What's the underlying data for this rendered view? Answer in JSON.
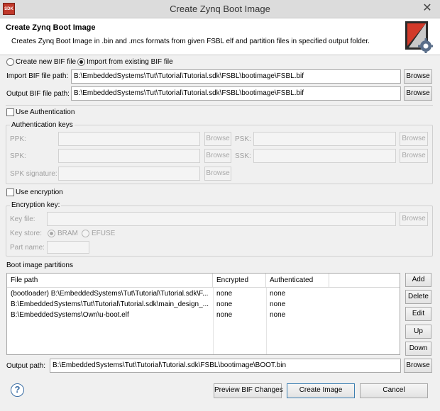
{
  "window": {
    "title": "Create Zynq Boot Image",
    "app_icon_text": "SDK",
    "close_glyph": "✕"
  },
  "header": {
    "title": "Create Zynq Boot Image",
    "description": "Creates Zynq Boot Image in .bin and .mcs formats from given FSBL elf and partition files in specified output folder."
  },
  "mode": {
    "create_new_label": "Create new BIF file",
    "import_label": "Import from existing BIF file",
    "selected": "import"
  },
  "import_bif": {
    "label": "Import BIF file path:",
    "value": "B:\\EmbeddedSystems\\Tut\\Tutorial\\Tutorial.sdk\\FSBL\\bootimage\\FSBL.bif",
    "browse_label": "Browse"
  },
  "output_bif": {
    "label": "Output BIF file path:",
    "value": "B:\\EmbeddedSystems\\Tut\\Tutorial\\Tutorial.sdk\\FSBL\\bootimage\\FSBL.bif",
    "browse_label": "Browse"
  },
  "authentication": {
    "checkbox_label": "Use Authentication",
    "checked": false,
    "group_label": "Authentication keys",
    "ppk_label": "PPK:",
    "psk_label": "PSK:",
    "spk_label": "SPK:",
    "ssk_label": "SSK:",
    "spk_signature_label": "SPK signature:",
    "browse_label": "Browse"
  },
  "encryption": {
    "checkbox_label": "Use encryption",
    "checked": false,
    "group_label": "Encryption key:",
    "key_file_label": "Key file:",
    "key_store_label": "Key store:",
    "bram_label": "BRAM",
    "efuse_label": "EFUSE",
    "key_store_selected": "BRAM",
    "part_name_label": "Part name:",
    "browse_label": "Browse"
  },
  "partitions": {
    "section_label": "Boot image partitions",
    "columns": [
      "File path",
      "Encrypted",
      "Authenticated"
    ],
    "rows": [
      {
        "path": "(bootloader) B:\\EmbeddedSystems\\Tut\\Tutorial\\Tutorial.sdk\\F...",
        "encrypted": "none",
        "authenticated": "none"
      },
      {
        "path": "B:\\EmbeddedSystems\\Tut\\Tutorial\\Tutorial.sdk\\main_design_...",
        "encrypted": "none",
        "authenticated": "none"
      },
      {
        "path": "B:\\EmbeddedSystems\\Own\\u-boot.elf",
        "encrypted": "none",
        "authenticated": "none"
      }
    ],
    "buttons": {
      "add": "Add",
      "delete": "Delete",
      "edit": "Edit",
      "up": "Up",
      "down": "Down"
    }
  },
  "output_path": {
    "label": "Output path:",
    "value": "B:\\EmbeddedSystems\\Tut\\Tutorial\\Tutorial.sdk\\FSBL\\bootimage\\BOOT.bin",
    "browse_label": "Browse"
  },
  "footer": {
    "help_glyph": "?",
    "preview_label": "Preview BIF Changes",
    "create_label": "Create Image",
    "cancel_label": "Cancel"
  }
}
